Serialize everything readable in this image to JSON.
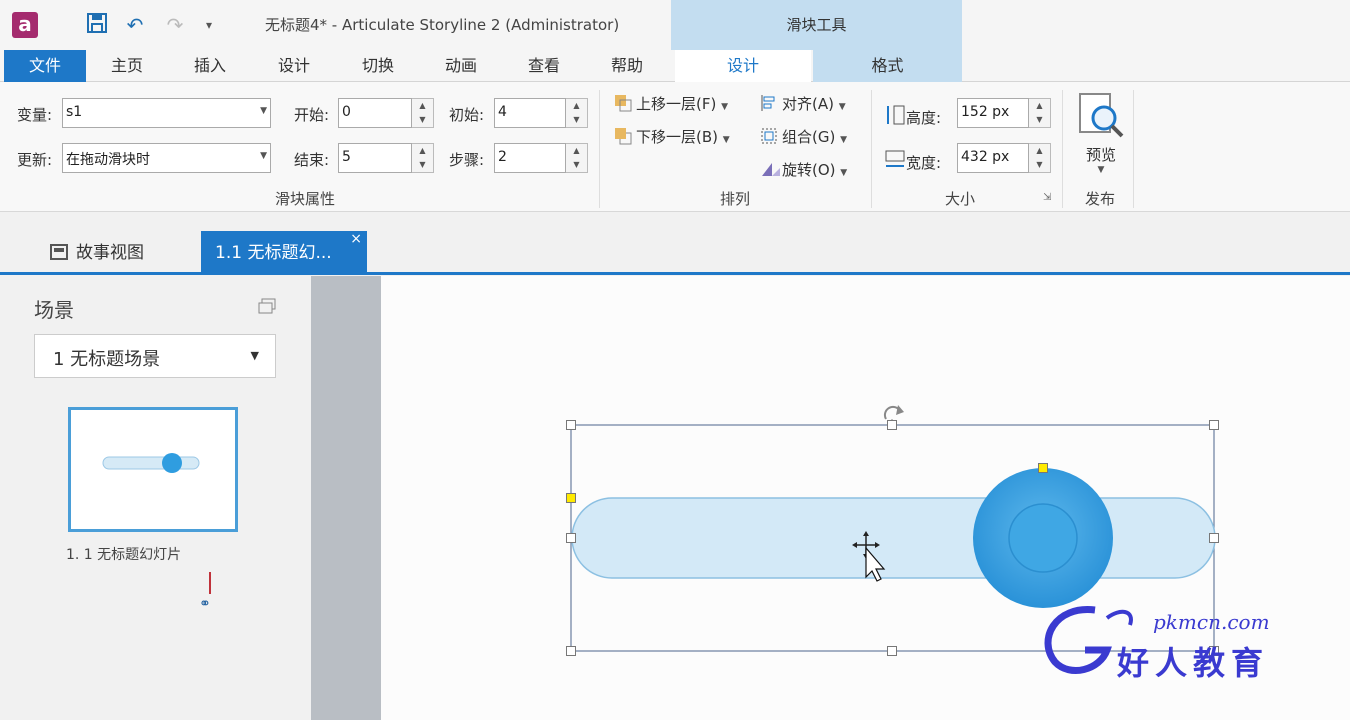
{
  "window": {
    "title": "无标题4* -  Articulate Storyline 2 (Administrator)",
    "context_tool": "滑块工具"
  },
  "tabs": {
    "file": "文件",
    "items": [
      "主页",
      "插入",
      "设计",
      "切换",
      "动画",
      "查看",
      "帮助"
    ],
    "context": [
      "设计",
      "格式"
    ]
  },
  "ribbon": {
    "slider_props": {
      "variable_label": "变量:",
      "variable_value": "s1",
      "update_label": "更新:",
      "update_value": "在拖动滑块时",
      "start_label": "开始:",
      "start_value": "0",
      "end_label": "结束:",
      "end_value": "5",
      "initial_label": "初始:",
      "initial_value": "4",
      "step_label": "步骤:",
      "step_value": "2",
      "group_label": "滑块属性"
    },
    "arrange": {
      "bring_forward": "上移一层(F)",
      "send_backward": "下移一层(B)",
      "align": "对齐(A)",
      "group": "组合(G)",
      "rotate": "旋转(O)",
      "group_label": "排列"
    },
    "size": {
      "height_label": "高度:",
      "height_value": "152 px",
      "width_label": "宽度:",
      "width_value": "432 px",
      "group_label": "大小"
    },
    "publish": {
      "preview_label": "预览",
      "group_label": "发布"
    }
  },
  "doc_tabs": {
    "story_view": "故事视图",
    "slide_tab": "1.1 无标题幻...",
    "close_glyph": "×"
  },
  "scenes": {
    "title": "场景",
    "selected": "1 无标题场景",
    "slide_caption": "1. 1 无标题幻灯片"
  },
  "watermark": {
    "text_top": "pkmcn.com",
    "text_bottom": "好人教育"
  }
}
